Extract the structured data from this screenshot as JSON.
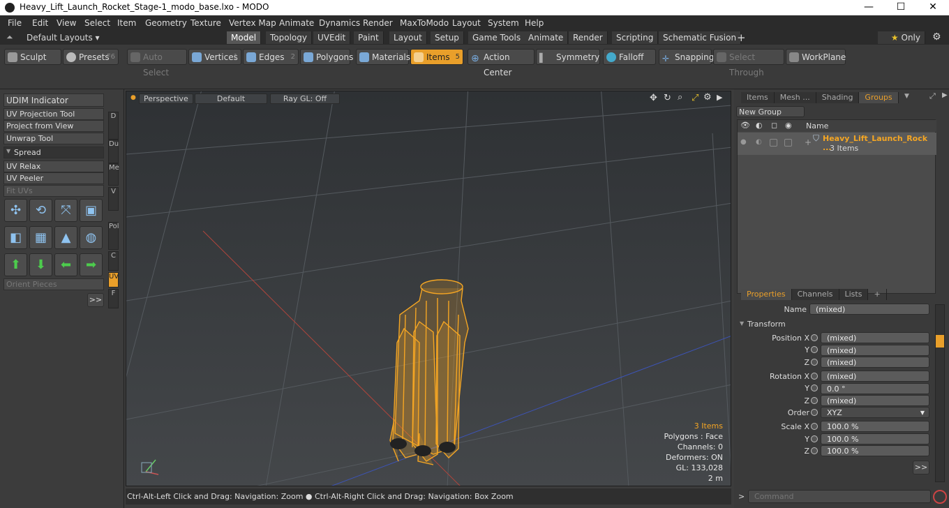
{
  "app": {
    "title": "Heavy_Lift_Launch_Rocket_Stage-1_modo_base.lxo - MODO",
    "win_min": "—",
    "win_max": "☐",
    "win_close": "✕"
  },
  "menu": [
    "File",
    "Edit",
    "View",
    "Select",
    "Item",
    "Geometry",
    "Texture",
    "Vertex Map",
    "Animate",
    "Dynamics",
    "Render",
    "MaxToModo",
    "Layout",
    "System",
    "Help"
  ],
  "layouts": {
    "label": "Default Layouts ▾"
  },
  "tabs": [
    "Model",
    "Topology",
    "UVEdit",
    "Paint",
    "Layout",
    "Setup",
    "Game Tools",
    "Animate",
    "Render",
    "Scripting",
    "Schematic Fusion",
    "+"
  ],
  "only_label": "Only",
  "toolbar": {
    "sculpt": "Sculpt",
    "presets": "Presets",
    "presets_key": "F6",
    "auto_select": "Auto Select",
    "vertices": "Vertices",
    "vertices_key": "1",
    "edges": "Edges",
    "edges_key": "2",
    "polygons": "Polygons",
    "materials": "Materials",
    "items": "Items",
    "items_key": "5",
    "action_center": "Action Center",
    "symmetry": "Symmetry",
    "falloff": "Falloff",
    "snapping": "Snapping",
    "select_through": "Select Through",
    "workplane": "WorkPlane"
  },
  "left": {
    "udim": "UDIM Indicator",
    "uv_proj": "UV Projection Tool",
    "proj_view": "Project from View",
    "unwrap": "Unwrap Tool",
    "spread": "Spread",
    "uv_relax": "UV Relax",
    "uv_peeler": "UV Peeler",
    "fit_uvs": "Fit UVs",
    "orient": "Orient Pieces",
    "more": ">>"
  },
  "vtabs": [
    "D",
    "Du",
    "Me",
    "V",
    "Pol",
    "C",
    "UV",
    "F"
  ],
  "viewport": {
    "perspective": "Perspective",
    "default": "Default",
    "raygl": "Ray GL: Off",
    "items": "3 Items",
    "polygons": "Polygons : Face",
    "channels": "Channels: 0",
    "deformers": "Deformers: ON",
    "gl": "GL: 133,028",
    "scale": "2 m"
  },
  "statusbar": "Ctrl-Alt-Left Click and Drag: Navigation: Zoom ● Ctrl-Alt-Right Click and Drag: Navigation: Box Zoom",
  "groups": {
    "tabs": [
      "Items",
      "Mesh ...",
      "Shading",
      "Groups"
    ],
    "new_group": "New Group",
    "col_name": "Name",
    "item_name": "Heavy_Lift_Launch_Rock ...",
    "item_sub": "3 Items"
  },
  "props": {
    "tabs": [
      "Properties",
      "Channels",
      "Lists",
      "+"
    ],
    "name_label": "Name",
    "name_val": "(mixed)",
    "transform": "Transform",
    "pos_x": "Position X",
    "y": "Y",
    "z": "Z",
    "rot_x": "Rotation X",
    "order": "Order",
    "order_val": "XYZ",
    "scale_x": "Scale X",
    "pos": [
      "(mixed)",
      "(mixed)",
      "(mixed)"
    ],
    "rot": [
      "(mixed)",
      "0.0 °",
      "(mixed)"
    ],
    "scale": [
      "100.0 %",
      "100.0 %",
      "100.0 %"
    ],
    "more": ">>"
  },
  "command": {
    "placeholder": "Command",
    "prompt": ">"
  }
}
